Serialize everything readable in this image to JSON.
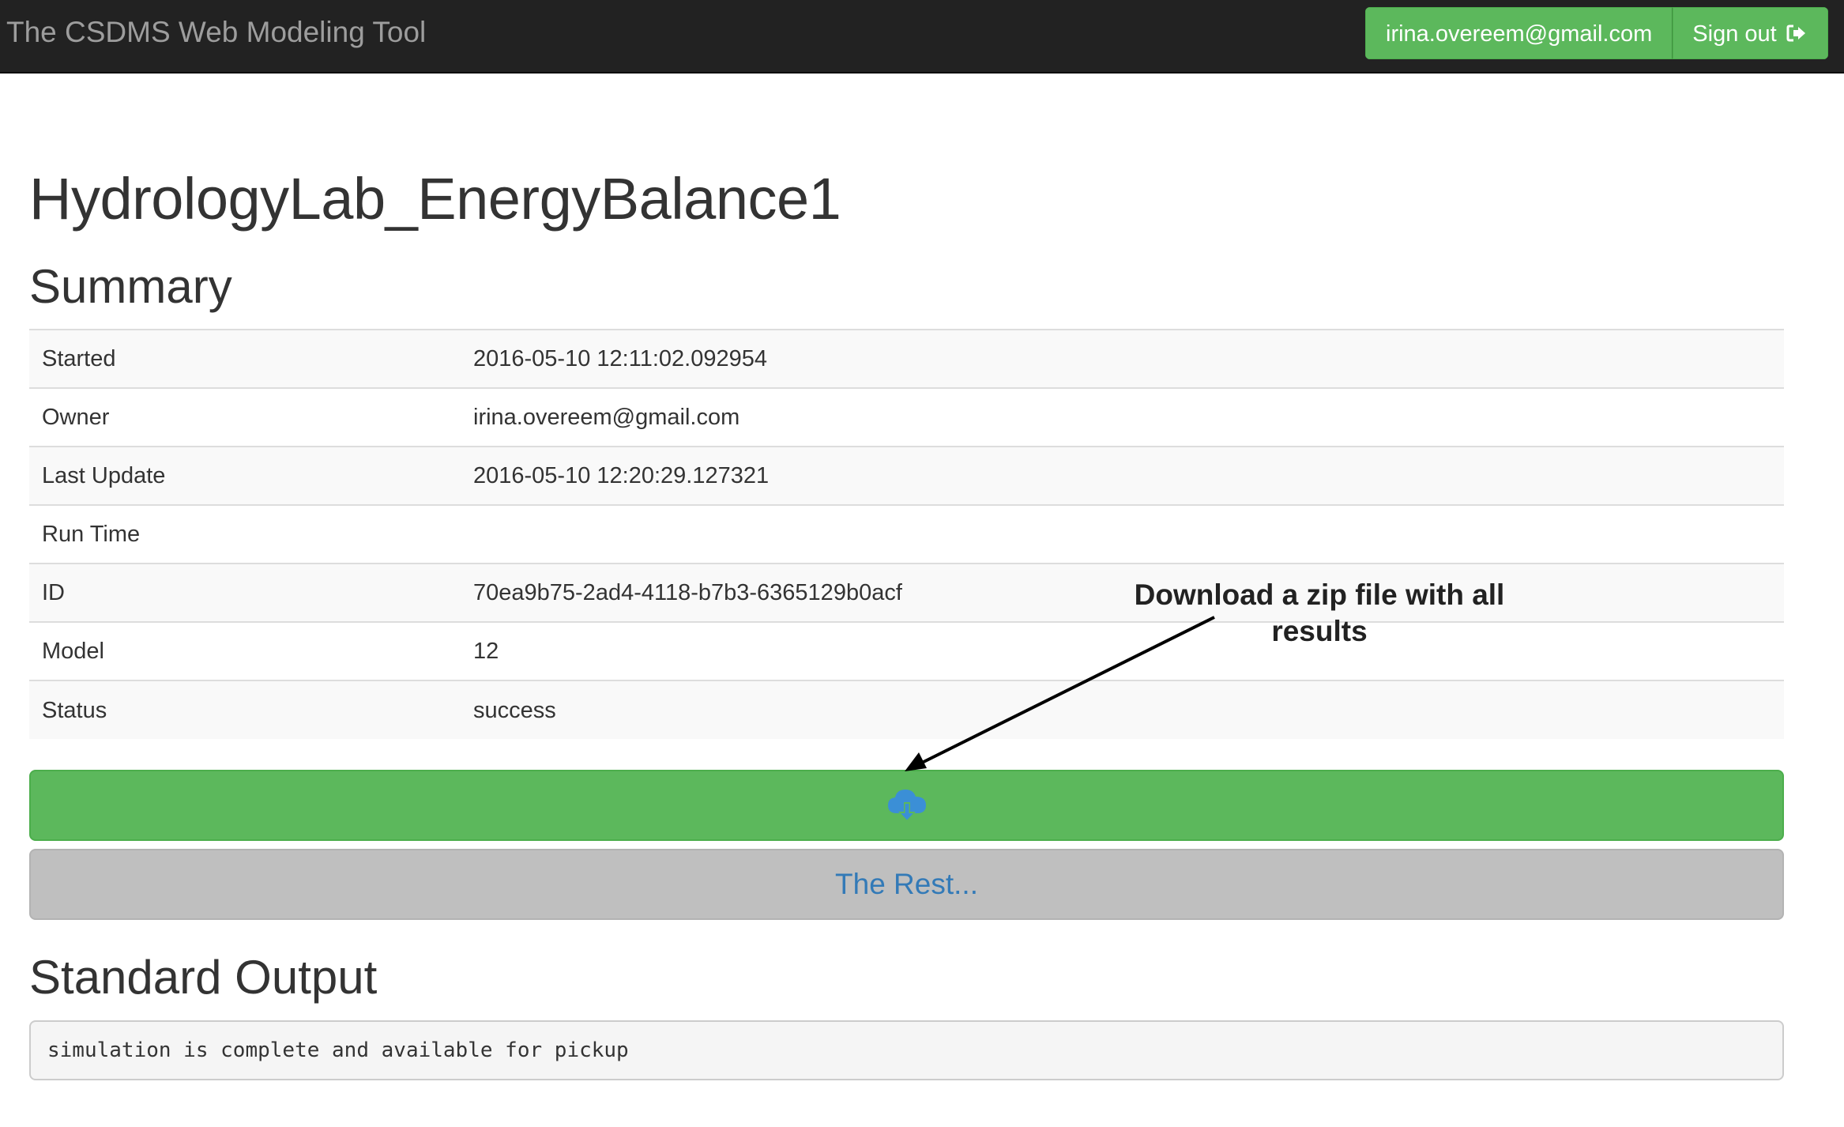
{
  "navbar": {
    "brand": "The CSDMS Web Modeling Tool",
    "user_email": "irina.overeem@gmail.com",
    "sign_out_label": "Sign out",
    "sign_out_icon": "sign-out-icon"
  },
  "page": {
    "title": "HydrologyLab_EnergyBalance1"
  },
  "summary": {
    "heading": "Summary",
    "rows": [
      {
        "label": "Started",
        "value": "2016-05-10 12:11:02.092954"
      },
      {
        "label": "Owner",
        "value": "irina.overeem@gmail.com"
      },
      {
        "label": "Last Update",
        "value": "2016-05-10 12:20:29.127321"
      },
      {
        "label": "Run Time",
        "value": ""
      },
      {
        "label": "ID",
        "value": "70ea9b75-2ad4-4118-b7b3-6365129b0acf"
      },
      {
        "label": "Model",
        "value": "12"
      },
      {
        "label": "Status",
        "value": "success"
      }
    ]
  },
  "download": {
    "icon": "cloud-download-icon",
    "annotation": "Download a zip file with all results"
  },
  "rest_button": {
    "label": "The Rest..."
  },
  "standard_output": {
    "heading": "Standard Output",
    "text": "simulation is complete and available for pickup"
  },
  "colors": {
    "navbar_bg": "#222222",
    "success_green": "#5cb85c",
    "link_blue": "#337ab7",
    "icon_blue": "#3b8fd6",
    "gray_button": "#bfbfbf"
  }
}
